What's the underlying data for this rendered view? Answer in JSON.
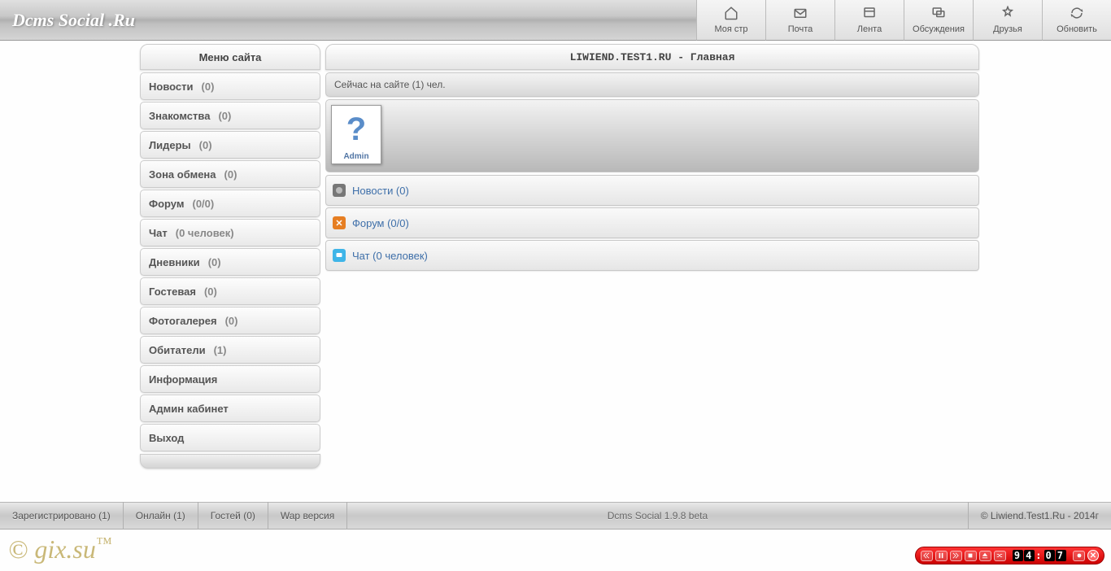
{
  "header": {
    "title": "Dcms Social .Ru",
    "nav": [
      {
        "label": "Моя стр",
        "icon": "home-icon"
      },
      {
        "label": "Почта",
        "icon": "mail-icon"
      },
      {
        "label": "Лента",
        "icon": "feed-icon"
      },
      {
        "label": "Обсуждения",
        "icon": "discuss-icon"
      },
      {
        "label": "Друзья",
        "icon": "friends-icon"
      },
      {
        "label": "Обновить",
        "icon": "refresh-icon"
      }
    ]
  },
  "sidebar": {
    "title": "Меню сайта",
    "items": [
      {
        "label": "Новости",
        "count": "(0)"
      },
      {
        "label": "Знакомства",
        "count": "(0)"
      },
      {
        "label": "Лидеры",
        "count": "(0)"
      },
      {
        "label": "Зона обмена",
        "count": "(0)"
      },
      {
        "label": "Форум",
        "count": "(0/0)"
      },
      {
        "label": "Чат",
        "count": "(0 человек)"
      },
      {
        "label": "Дневники",
        "count": "(0)"
      },
      {
        "label": "Гостевая",
        "count": "(0)"
      },
      {
        "label": "Фотогалерея",
        "count": "(0)"
      },
      {
        "label": "Обитатели",
        "count": "(1)"
      },
      {
        "label": "Информация",
        "count": ""
      },
      {
        "label": "Админ кабинет",
        "count": ""
      },
      {
        "label": "Выход",
        "count": ""
      }
    ]
  },
  "content": {
    "title": "LIWIEND.TEST1.RU - Главная",
    "online_text": "Сейчас на сайте (1) чел.",
    "user": {
      "name": "Admin",
      "avatar": "?"
    },
    "rows": [
      {
        "label": "Новости (0)",
        "icon_bg": "#777",
        "icon_fg": "#ddd"
      },
      {
        "label": "Форум (0/0)",
        "icon_bg": "#e67e22",
        "icon_fg": "#fff"
      },
      {
        "label": "Чат (0 человек)",
        "icon_bg": "#3fb5e8",
        "icon_fg": "#fff"
      }
    ]
  },
  "footer": {
    "items": [
      {
        "label": "Зарегистрировано (1)"
      },
      {
        "label": "Онлайн (1)"
      },
      {
        "label": "Гостей (0)"
      },
      {
        "label": "Wap версия"
      }
    ],
    "center": "Dcms Social 1.9.8 beta",
    "right": "© Liwiend.Test1.Ru - 2014г"
  },
  "watermark": "© gix.su™",
  "player": {
    "time": "94:07"
  }
}
